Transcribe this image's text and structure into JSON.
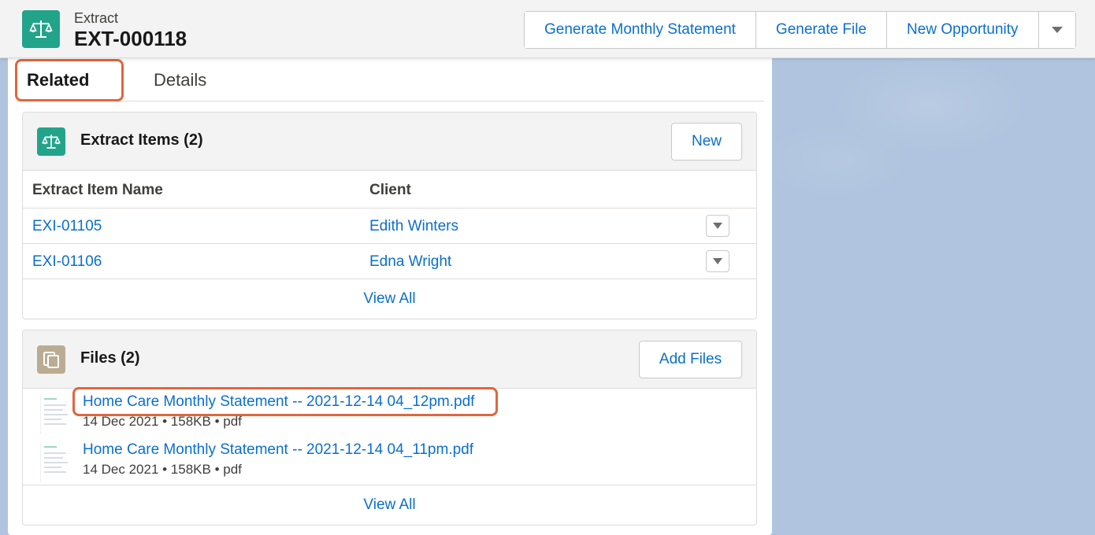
{
  "header": {
    "object_type": "Extract",
    "record_name": "EXT-000118",
    "actions": [
      "Generate Monthly Statement",
      "Generate File",
      "New Opportunity"
    ],
    "icon": "scales-icon",
    "menu_icon": "chevron-down-icon"
  },
  "tabs": {
    "related": "Related",
    "details": "Details"
  },
  "extract_items": {
    "title": "Extract Items (2)",
    "new_button": "New",
    "icon": "scales-icon",
    "columns": {
      "name": "Extract Item Name",
      "client": "Client"
    },
    "rows": [
      {
        "name": "EXI-01105",
        "client": "Edith Winters"
      },
      {
        "name": "EXI-01106",
        "client": "Edna Wright"
      }
    ],
    "view_all": "View All"
  },
  "files": {
    "title": "Files (2)",
    "add_button": "Add Files",
    "icon": "files-icon",
    "items": [
      {
        "name": "Home Care Monthly Statement -- 2021-12-14 04_12pm.pdf",
        "meta": "14 Dec 2021  •  158KB  •  pdf"
      },
      {
        "name": "Home Care Monthly Statement -- 2021-12-14 04_11pm.pdf",
        "meta": "14 Dec 2021  •  158KB  •  pdf"
      }
    ],
    "view_all": "View All"
  },
  "colors": {
    "accent": "#0b6fcc",
    "extract_icon_bg": "#22a48a",
    "files_icon_bg": "#baac93",
    "highlight": "#e0663d"
  }
}
